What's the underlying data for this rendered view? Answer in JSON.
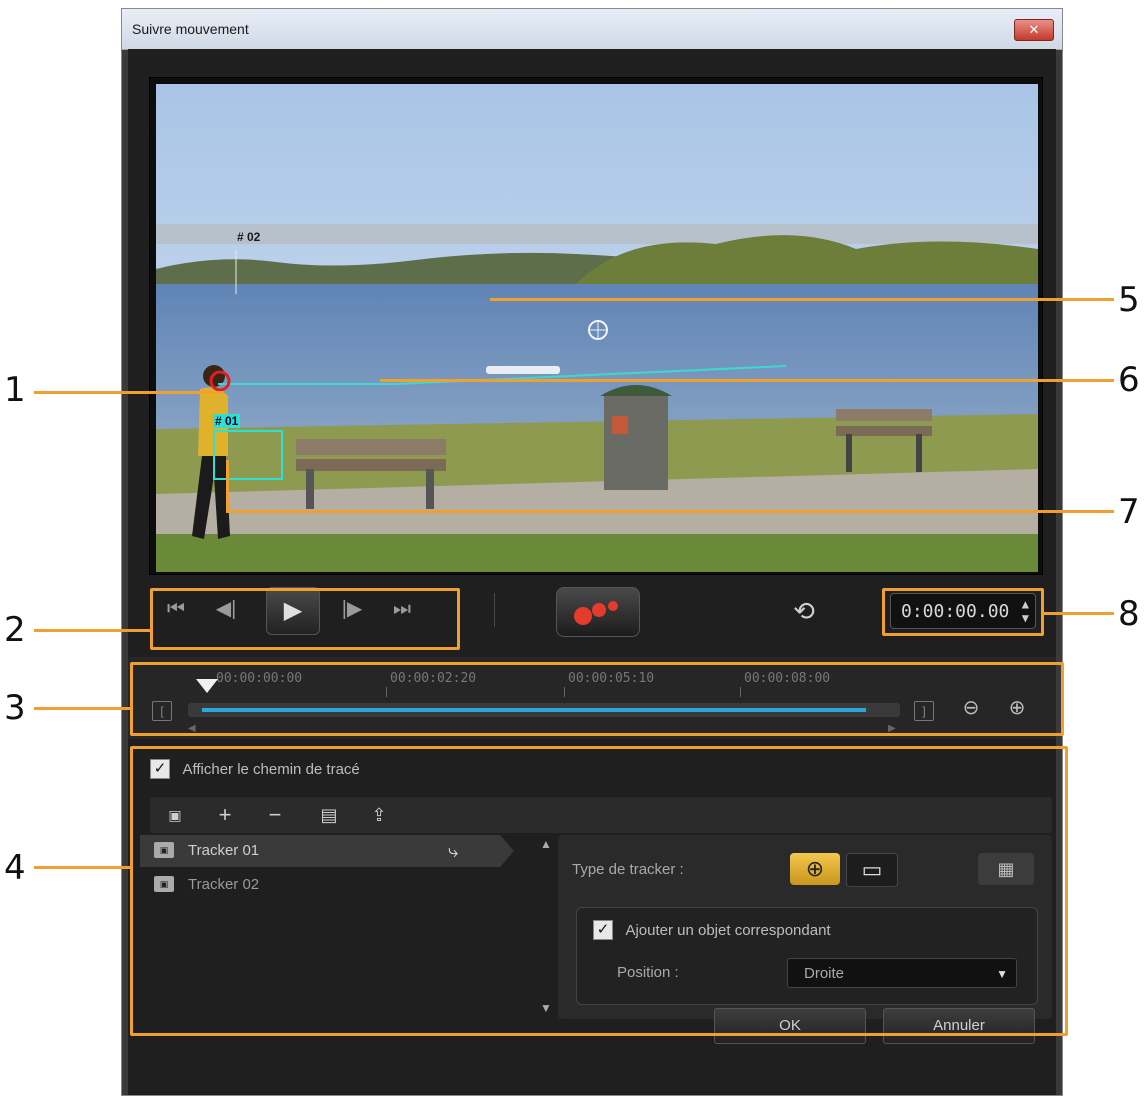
{
  "dialog": {
    "title": "Suivre mouvement",
    "close_glyph": "✕"
  },
  "preview": {
    "tracker_labels": [
      "# 02",
      "# 01"
    ]
  },
  "playback": {
    "icons": [
      "go-to-start-icon",
      "step-back-icon",
      "play-icon",
      "step-forward-icon",
      "go-to-end-icon",
      "record-icon",
      "reset-history-icon"
    ],
    "timecode": "0:00:00.00"
  },
  "timeline": {
    "ticks": [
      "00:00:00:00",
      "00:00:02:20",
      "00:00:05:10",
      "00:00:08:00"
    ]
  },
  "panel": {
    "show_path_label": "Afficher le chemin de tracé",
    "show_path_checked": true,
    "trackers": [
      {
        "name": "Tracker 01",
        "selected": true
      },
      {
        "name": "Tracker 02",
        "selected": false
      }
    ],
    "tracker_type_label": "Type de tracker :",
    "add_object_label": "Ajouter un objet correspondant",
    "add_object_checked": true,
    "position_label": "Position :",
    "position_value": "Droite"
  },
  "buttons": {
    "ok": "OK",
    "cancel": "Annuler"
  },
  "callouts": [
    "1",
    "2",
    "3",
    "4",
    "5",
    "6",
    "7",
    "8"
  ],
  "colors": {
    "callout": "#f0a030",
    "tracker_active": "#2de0d0",
    "timeline_fill": "#2aa9d8",
    "type_button_active": "#f2c94c"
  }
}
